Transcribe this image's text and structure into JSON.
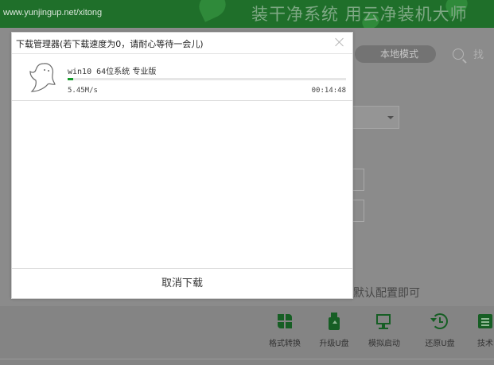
{
  "app": {
    "url": "www.yunjingup.net/xitong",
    "slogan": "装干净系统 用云净装机大师",
    "mode_label": "本地模式",
    "search_label": "找",
    "config_hint": "默认配置即可",
    "tools": [
      {
        "label": "格式转换",
        "icon": "format-convert-icon"
      },
      {
        "label": "升级U盘",
        "icon": "usb-upgrade-icon"
      },
      {
        "label": "模拟启动",
        "icon": "monitor-icon"
      },
      {
        "label": "还原U盘",
        "icon": "restore-clock-icon"
      },
      {
        "label": "技术",
        "icon": "tech-doc-icon"
      }
    ],
    "colors": {
      "header": "#1f6f2a",
      "icon": "#165e24"
    }
  },
  "dialog": {
    "title": "下载管理器(若下载速度为0，请耐心等待一会儿)",
    "item": {
      "name_prefix": "win10 64",
      "name_suffix": "位系统 专业版",
      "speed": "5.45M/s",
      "time": "00:14:48",
      "progress": 0.02,
      "progress_color": "#139b2a"
    },
    "cancel_label": "取消下载"
  }
}
